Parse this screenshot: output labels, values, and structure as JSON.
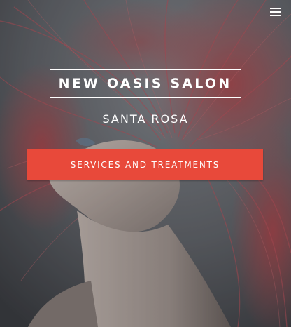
{
  "header": {
    "menu_icon": "hamburger-menu-icon"
  },
  "hero": {
    "title": "NEW OASIS SALON",
    "subtitle": "SANTA ROSA",
    "cta_label": "SERVICES AND TREATMENTS",
    "image_description": "woman with flowing red hair"
  },
  "colors": {
    "accent": "#e8493a",
    "text": "#ffffff",
    "background": "#5b5e64",
    "hair": "#b5484e"
  }
}
